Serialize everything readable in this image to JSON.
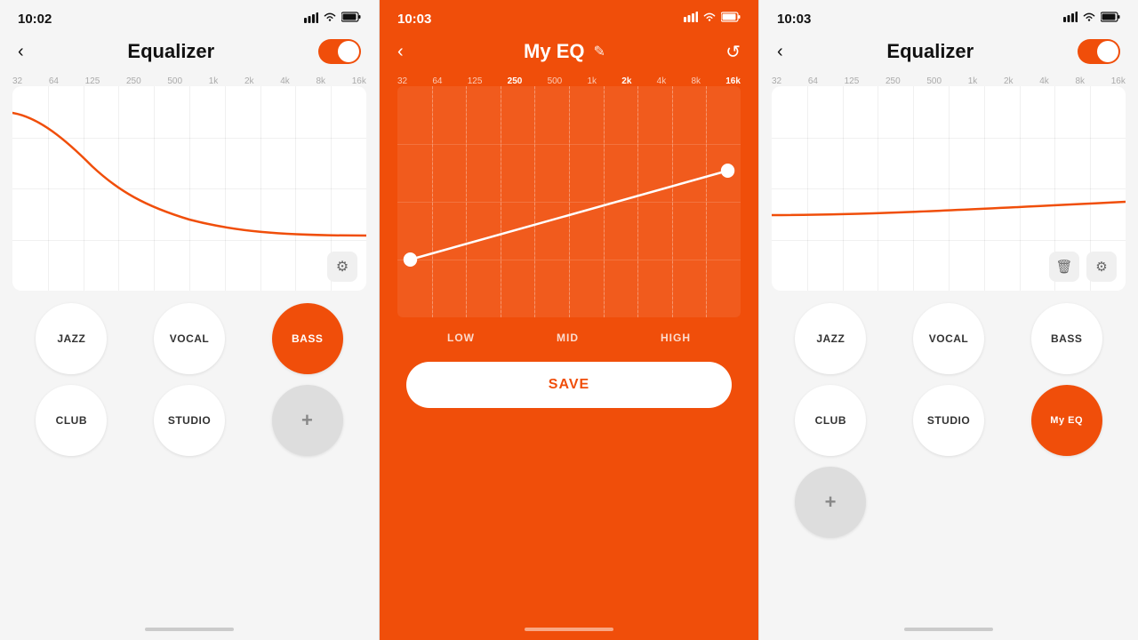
{
  "panels": [
    {
      "id": "left",
      "status": {
        "time": "10:02",
        "signal": "▲▲▲",
        "wifi": "wifi",
        "battery": "battery"
      },
      "title": "Equalizer",
      "toggle": true,
      "freq_labels": [
        "32",
        "64",
        "125",
        "250",
        "500",
        "1k",
        "2k",
        "4k",
        "8k",
        "16k"
      ],
      "active_freq": null,
      "curve_type": "bass_boost",
      "presets": [
        {
          "label": "JAZZ",
          "active": false
        },
        {
          "label": "VOCAL",
          "active": false
        },
        {
          "label": "BASS",
          "active": true
        },
        {
          "label": "CLUB",
          "active": false
        },
        {
          "label": "STUDIO",
          "active": false
        },
        {
          "label": "+",
          "type": "add"
        }
      ]
    },
    {
      "id": "center",
      "status": {
        "time": "10:03",
        "signal": "▲▲▲",
        "wifi": "wifi",
        "battery": "battery"
      },
      "title": "My EQ",
      "freq_labels": [
        "32",
        "64",
        "125",
        "250",
        "500",
        "1k",
        "2k",
        "4k",
        "8k",
        "16k"
      ],
      "active_freq": "250",
      "curve_type": "rising",
      "bands": [
        "LOW",
        "MID",
        "HIGH"
      ],
      "save_label": "SAVE"
    },
    {
      "id": "right",
      "status": {
        "time": "10:03",
        "signal": "▲▲▲",
        "wifi": "wifi",
        "battery": "battery"
      },
      "title": "Equalizer",
      "toggle": true,
      "freq_labels": [
        "32",
        "64",
        "125",
        "250",
        "500",
        "1k",
        "2k",
        "4k",
        "8k",
        "16k"
      ],
      "active_freq": null,
      "curve_type": "flat_rising",
      "presets": [
        {
          "label": "JAZZ",
          "active": false
        },
        {
          "label": "VOCAL",
          "active": false
        },
        {
          "label": "BASS",
          "active": false
        },
        {
          "label": "CLUB",
          "active": false
        },
        {
          "label": "STUDIO",
          "active": false
        },
        {
          "label": "My EQ",
          "type": "myeq",
          "active": true
        },
        {
          "label": "+",
          "type": "add"
        }
      ]
    }
  ]
}
